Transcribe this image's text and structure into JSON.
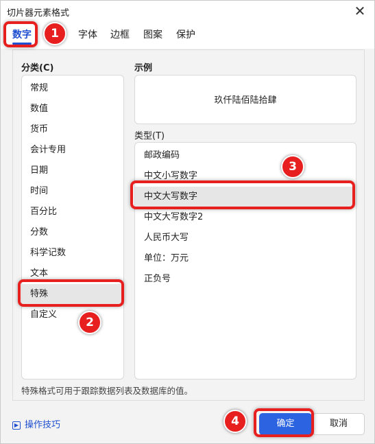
{
  "window": {
    "title": "切片器元素格式",
    "close_icon": "close-icon"
  },
  "tabs": [
    {
      "label": "数字",
      "active": true
    },
    {
      "label": "字体"
    },
    {
      "label": "边框"
    },
    {
      "label": "图案"
    },
    {
      "label": "保护"
    }
  ],
  "category": {
    "label": "分类(C)",
    "items": [
      "常规",
      "数值",
      "货币",
      "会计专用",
      "日期",
      "时间",
      "百分比",
      "分数",
      "科学记数",
      "文本",
      "特殊",
      "自定义"
    ],
    "selected": "特殊"
  },
  "sample": {
    "label": "示例",
    "value": "玖仟陆佰陆拾肆"
  },
  "type": {
    "label": "类型(T)",
    "items": [
      "邮政编码",
      "中文小写数字",
      "中文大写数字",
      "中文大写数字2",
      "人民币大写",
      "单位：万元",
      "正负号"
    ],
    "selected": "中文大写数字"
  },
  "description": "特殊格式可用于跟踪数据列表及数据库的值。",
  "footer": {
    "tips_label": "操作技巧",
    "ok_label": "确定",
    "cancel_label": "取消"
  },
  "annotations": {
    "badges": [
      "1",
      "2",
      "3",
      "4"
    ],
    "color": "#e81f1f"
  },
  "colors": {
    "accent": "#1f4fd1",
    "ok_button": "#2b63e0"
  }
}
